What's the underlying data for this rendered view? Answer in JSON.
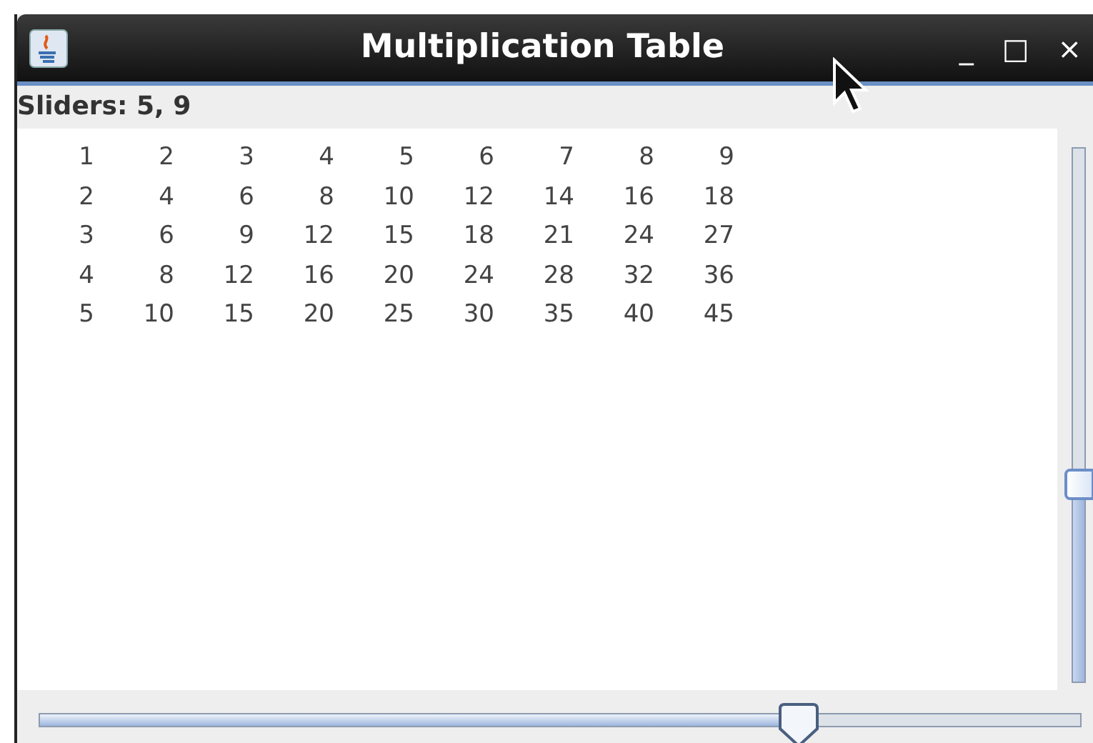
{
  "window": {
    "title": "Multiplication Table",
    "controls": [
      "_",
      "□",
      "×"
    ]
  },
  "label": "Sliders: 5, 9",
  "table": {
    "rows": [
      [
        "1",
        "2",
        "3",
        "4",
        "5",
        "6",
        "7",
        "8",
        "9"
      ],
      [
        "2",
        "4",
        "6",
        "8",
        "10",
        "12",
        "14",
        "16",
        "18"
      ],
      [
        "3",
        "6",
        "9",
        "12",
        "15",
        "18",
        "21",
        "24",
        "27"
      ],
      [
        "4",
        "8",
        "12",
        "16",
        "20",
        "24",
        "28",
        "32",
        "36"
      ],
      [
        "5",
        "10",
        "15",
        "20",
        "25",
        "30",
        "35",
        "40",
        "45"
      ]
    ]
  },
  "vertical_slider": {
    "level": 0.37
  },
  "horizontal_slider": {
    "level": 0.73
  }
}
